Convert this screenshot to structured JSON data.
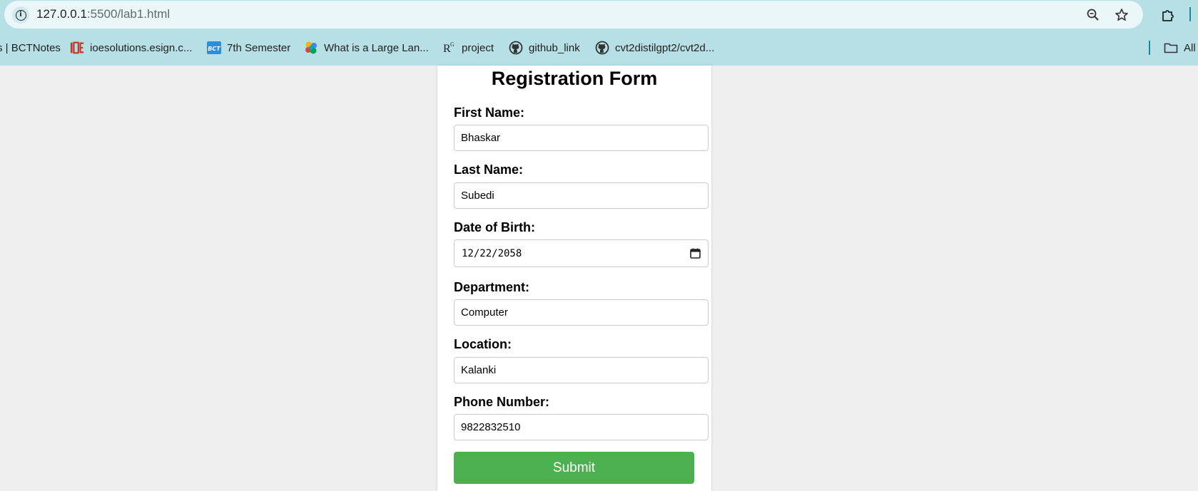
{
  "browser": {
    "url_host": "127.0.0.1",
    "url_rest": ":5500/lab1.html",
    "bookmarks": [
      {
        "label": "s | BCTNotes",
        "icon": "none"
      },
      {
        "label": "ioesolutions.esign.c...",
        "icon": "ioe-logo-icon"
      },
      {
        "label": "7th Semester",
        "icon": "bct-logo-icon"
      },
      {
        "label": "What is a Large Lan...",
        "icon": "colorful-dots-icon"
      },
      {
        "label": "project",
        "icon": "r-logo-icon"
      },
      {
        "label": "github_link",
        "icon": "github-icon"
      },
      {
        "label": "cvt2distilgpt2/cvt2d...",
        "icon": "github-icon"
      },
      {
        "label": "All",
        "icon": "folder-icon"
      }
    ],
    "colors": {
      "chrome": "#b6e0e5",
      "omnibox": "#eaf6f7",
      "accent": "#1a8a9a"
    }
  },
  "form": {
    "title": "Registration Form",
    "fields": [
      {
        "label": "First Name:",
        "value": "Bhaskar"
      },
      {
        "label": "Last Name:",
        "value": "Subedi"
      },
      {
        "label": "Date of Birth:",
        "value": "12/22/2058"
      },
      {
        "label": "Department:",
        "value": "Computer"
      },
      {
        "label": "Location:",
        "value": "Kalanki"
      },
      {
        "label": "Phone Number:",
        "value": "9822832510"
      }
    ],
    "submit_label": "Submit",
    "colors": {
      "submit": "#4caf50",
      "background": "#efefef"
    }
  }
}
